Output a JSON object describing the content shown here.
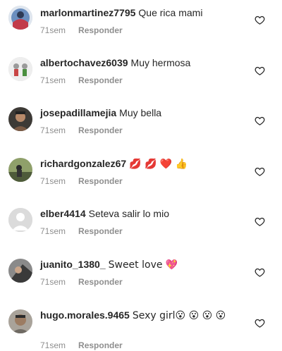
{
  "comments": [
    {
      "username": "marlonmartinez7795",
      "text": "Que rica mami",
      "time": "71sem",
      "reply": "Responder",
      "avatar_color": "#6b8fbf"
    },
    {
      "username": "albertochavez6039",
      "text": "Muy hermosa",
      "time": "71sem",
      "reply": "Responder",
      "avatar_color": "#e7e7e7"
    },
    {
      "username": "josepadillamejia",
      "text": "Muy bella",
      "time": "71sem",
      "reply": "Responder",
      "avatar_color": "#7a5a45"
    },
    {
      "username": "richardgonzalez67",
      "text": "💋 💋 ❤️ 👍",
      "time": "71sem",
      "reply": "Responder",
      "avatar_color": "#4e5b3a"
    },
    {
      "username": "elber4414",
      "text": "Seteva salir lo mio",
      "time": "71sem",
      "reply": "Responder",
      "avatar_color": "#dbdbdb"
    },
    {
      "username": "juanito_1380_",
      "text": "Sweet love 💖",
      "time": "71sem",
      "reply": "Responder",
      "avatar_color": "#555555"
    },
    {
      "username": "hugo.morales.9465",
      "text": "Sexy girl😮 😮 😮 😮",
      "time": "71sem",
      "reply": "Responder",
      "avatar_color": "#6f6a63"
    }
  ],
  "icons": {
    "like": "heart-outline-icon"
  },
  "colors": {
    "text": "#262626",
    "meta": "#8e8e8e",
    "background": "#ffffff"
  }
}
